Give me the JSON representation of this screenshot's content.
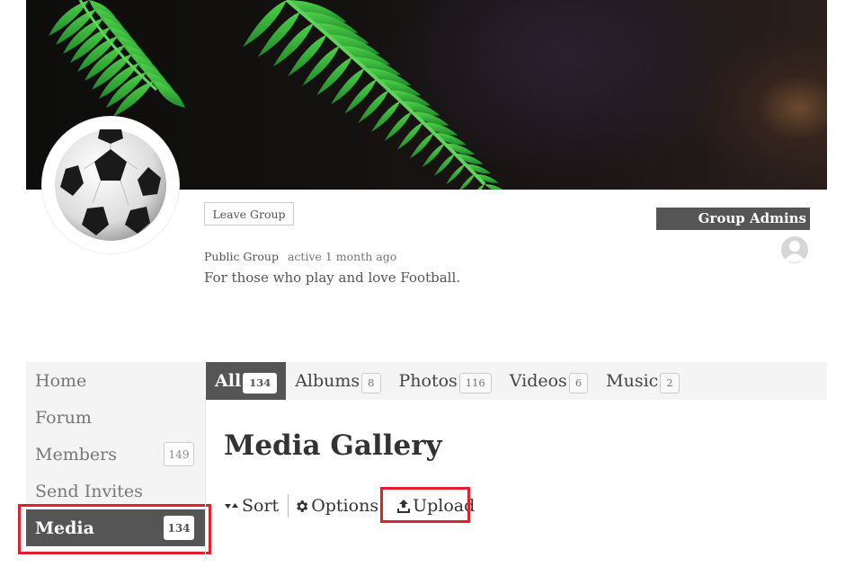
{
  "group": {
    "leave_label": "Leave Group",
    "type": "Public Group",
    "activity": "active 1 month ago",
    "description": "For those who play and love Football.",
    "admins_label": "Group Admins"
  },
  "sidebar": {
    "items": [
      {
        "label": "Home"
      },
      {
        "label": "Forum"
      },
      {
        "label": "Members",
        "count": "149"
      },
      {
        "label": "Send Invites"
      },
      {
        "label": "Media",
        "count": "134"
      }
    ],
    "active": "Media"
  },
  "media_tabs": [
    {
      "label": "All",
      "count": "134"
    },
    {
      "label": "Albums",
      "count": "8"
    },
    {
      "label": "Photos",
      "count": "116"
    },
    {
      "label": "Videos",
      "count": "6"
    },
    {
      "label": "Music",
      "count": "2"
    }
  ],
  "gallery": {
    "title": "Media Gallery",
    "sort_label": "Sort",
    "options_label": "Options",
    "upload_label": "Upload"
  },
  "colors": {
    "active_bg": "#555555",
    "highlight": "#e0202a",
    "fern": "#3fbf3a"
  },
  "icons": [
    "sort-icon",
    "gear-icon",
    "upload-icon",
    "admin-avatar-icon"
  ]
}
